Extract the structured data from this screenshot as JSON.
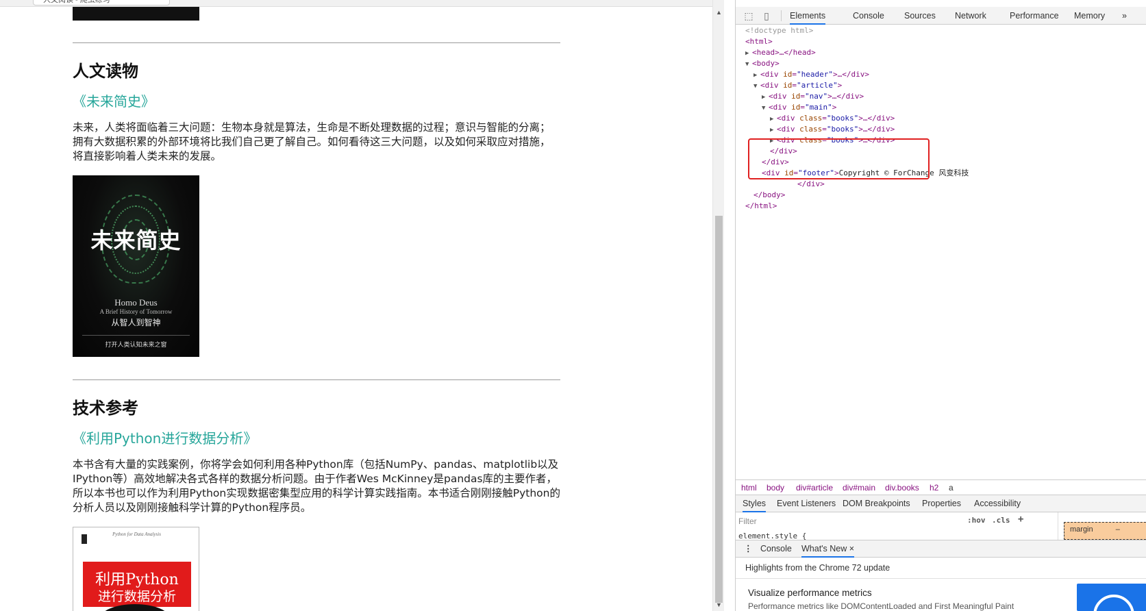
{
  "browser": {
    "tab_title": "人文阅读 - 爬虫练习"
  },
  "page": {
    "sections": [
      {
        "heading": "人文读物",
        "book_title": "《未来简史》",
        "description": "未来，人类将面临着三大问题：生物本身就是算法，生命是不断处理数据的过程；意识与智能的分离；拥有大数据积累的外部环境将比我们自己更了解自己。如何看待这三大问题，以及如何采取应对措施，将直接影响着人类未来的发展。",
        "cover": {
          "title": "未来简史",
          "english_title": "Homo Deus",
          "english_subtitle": "A Brief History of Tomorrow",
          "subtitle": "从智人到智神",
          "tagline": "打开人类认知未来之窗"
        }
      },
      {
        "heading": "技术参考",
        "book_title": "《利用Python进行数据分析》",
        "description": "本书含有大量的实践案例，你将学会如何利用各种Python库（包括NumPy、pandas、matplotlib以及IPython等）高效地解决各式各样的数据分析问题。由于作者Wes McKinney是pandas库的主要作者，所以本书也可以作为利用Python实现数据密集型应用的科学计算实践指南。本书适合刚刚接触Python的分析人员以及刚刚接触科学计算的Python程序员。",
        "cover": {
          "top_text": "Python for Data Analysis",
          "title_line1": "利用Python",
          "title_line2": "进行数据分析"
        }
      }
    ]
  },
  "devtools": {
    "tabs": [
      "Elements",
      "Console",
      "Sources",
      "Network",
      "Performance",
      "Memory"
    ],
    "active_tab": "Elements",
    "more": "»",
    "dom": {
      "doctype": "<!doctype html>",
      "html_open": "<html>",
      "head": "<head>…</head>",
      "body_open": "<body>",
      "header": {
        "tag": "div",
        "attr": "id",
        "value": "header"
      },
      "article": {
        "tag": "div",
        "attr": "id",
        "value": "article"
      },
      "nav": {
        "tag": "div",
        "attr": "id",
        "value": "nav"
      },
      "main": {
        "tag": "div",
        "attr": "id",
        "value": "main"
      },
      "books": [
        {
          "tag": "div",
          "attr": "class",
          "value": "books"
        },
        {
          "tag": "div",
          "attr": "class",
          "value": "books"
        },
        {
          "tag": "div",
          "attr": "class",
          "value": "books"
        }
      ],
      "footer": {
        "tag": "div",
        "attr": "id",
        "value": "footer",
        "text": "Copyright © ForChange 风变科技"
      },
      "close_div": "</div>",
      "body_close": "</body>",
      "html_close": "</html>"
    },
    "breadcrumbs": [
      "html",
      "body",
      "div#article",
      "div#main",
      "div.books",
      "h2",
      "a"
    ],
    "subtabs": [
      "Styles",
      "Event Listeners",
      "DOM Breakpoints",
      "Properties",
      "Accessibility"
    ],
    "active_subtab": "Styles",
    "filter_placeholder": "Filter",
    "hov_label": ":hov",
    "cls_label": ".cls",
    "plus_label": "+",
    "element_style": "element.style {",
    "box_model": {
      "margin_label": "margin",
      "margin_value": "–"
    },
    "drawer": {
      "tabs": [
        "Console",
        "What's New"
      ],
      "active_tab": "What's New",
      "close": "×",
      "header": "Highlights from the Chrome 72 update",
      "card_title": "Visualize performance metrics",
      "card_text": "Performance metrics like DOMContentLoaded and First Meaningful Paint"
    },
    "colors": {
      "tag": "#881280",
      "attr": "#994500",
      "value": "#1a1aa6",
      "accent": "#1a73e8",
      "highlight": "#e02020",
      "link": "#26a69a"
    }
  }
}
